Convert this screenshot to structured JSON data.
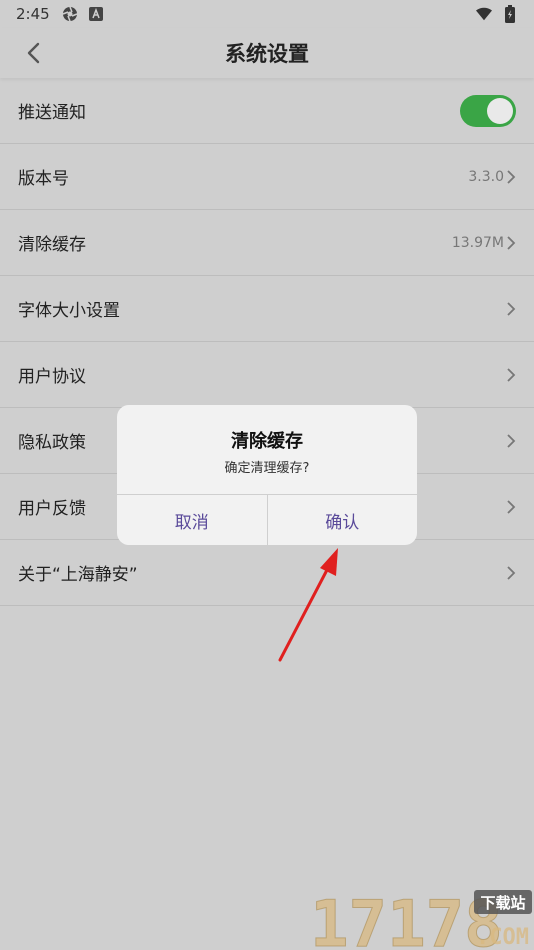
{
  "status_bar": {
    "time": "2:45"
  },
  "header": {
    "title": "系统设置"
  },
  "settings": {
    "push": {
      "label": "推送通知",
      "enabled": true
    },
    "version": {
      "label": "版本号",
      "value": "3.3.0"
    },
    "cache": {
      "label": "清除缓存",
      "value": "13.97M"
    },
    "font": {
      "label": "字体大小设置"
    },
    "agreement": {
      "label": "用户协议"
    },
    "privacy": {
      "label": "隐私政策"
    },
    "feedback": {
      "label": "用户反馈"
    },
    "about": {
      "label": "关于“上海静安”"
    }
  },
  "dialog": {
    "title": "清除缓存",
    "message": "确定清理缓存?",
    "cancel": "取消",
    "confirm": "确认"
  },
  "watermark": {
    "text": "17178",
    "badge": "下载站",
    "domain": ".COM"
  },
  "colors": {
    "toggle_on": "#3aa546",
    "dialog_button": "#5a4a9a",
    "arrow": "#e0201f"
  }
}
